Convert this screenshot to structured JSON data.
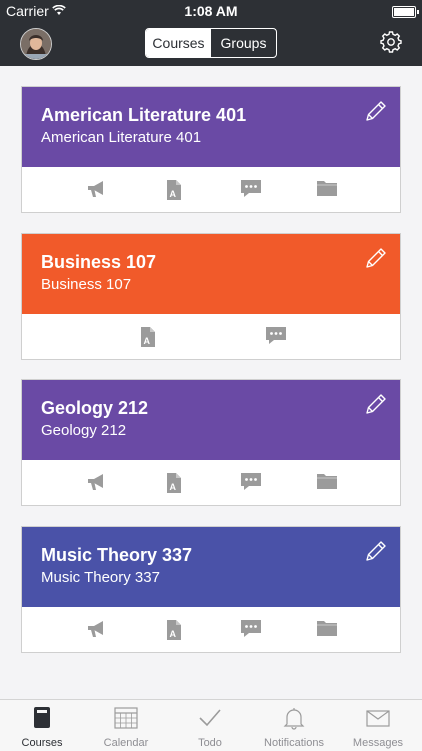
{
  "status": {
    "carrier": "Carrier",
    "time": "1:08 AM"
  },
  "nav": {
    "segments": [
      "Courses",
      "Groups"
    ],
    "active": "Courses"
  },
  "courses": [
    {
      "title": "American Literature 401",
      "subtitle": "American Literature 401",
      "color": "#6a4aa5",
      "icons": [
        "announcements-icon",
        "assignments-icon",
        "discussions-icon",
        "files-icon"
      ]
    },
    {
      "title": "Business 107",
      "subtitle": "Business 107",
      "color": "#f15a2a",
      "icons": [
        "assignments-icon",
        "discussions-icon"
      ]
    },
    {
      "title": "Geology 212",
      "subtitle": "Geology 212",
      "color": "#6a4aa5",
      "icons": [
        "announcements-icon",
        "assignments-icon",
        "discussions-icon",
        "files-icon"
      ]
    },
    {
      "title": "Music Theory 337",
      "subtitle": "Music Theory 337",
      "color": "#4a52a8",
      "icons": [
        "announcements-icon",
        "assignments-icon",
        "discussions-icon",
        "files-icon"
      ]
    }
  ],
  "tabbar": [
    {
      "label": "Courses",
      "icon": "courses-icon",
      "active": true
    },
    {
      "label": "Calendar",
      "icon": "calendar-icon",
      "active": false
    },
    {
      "label": "Todo",
      "icon": "todo-icon",
      "active": false
    },
    {
      "label": "Notifications",
      "icon": "bell-icon",
      "active": false
    },
    {
      "label": "Messages",
      "icon": "envelope-icon",
      "active": false
    }
  ]
}
